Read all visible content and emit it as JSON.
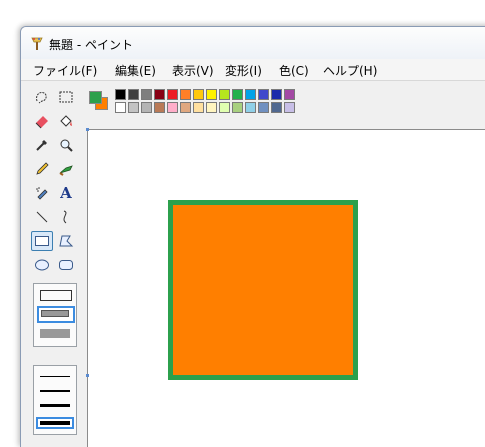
{
  "window": {
    "title": "無題 - ペイント"
  },
  "menu": [
    {
      "label": "ファイル(F)"
    },
    {
      "label": "編集(E)"
    },
    {
      "label": "表示(V)"
    },
    {
      "label": "変形(I)"
    },
    {
      "label": "色(C)"
    },
    {
      "label": "ヘルプ(H)"
    }
  ],
  "tools": [
    {
      "icon": "free-select-icon"
    },
    {
      "icon": "rect-select-icon"
    },
    {
      "icon": "eraser-icon"
    },
    {
      "icon": "fill-bucket-icon"
    },
    {
      "icon": "eyedropper-icon"
    },
    {
      "icon": "magnifier-icon"
    },
    {
      "icon": "pencil-icon"
    },
    {
      "icon": "brush-icon"
    },
    {
      "icon": "airbrush-icon"
    },
    {
      "icon": "text-icon",
      "glyph": "A"
    },
    {
      "icon": "line-icon"
    },
    {
      "icon": "curve-icon"
    },
    {
      "icon": "rectangle-icon",
      "selected": true
    },
    {
      "icon": "polygon-icon"
    },
    {
      "icon": "ellipse-icon"
    },
    {
      "icon": "rounded-rect-icon"
    }
  ],
  "colors": {
    "foreground": "#2ca04c",
    "background": "#ff7f00",
    "palette_row1": [
      "#000000",
      "#404040",
      "#7f7f7f",
      "#880015",
      "#ed1c24",
      "#ff7f27",
      "#ffc90e",
      "#fff200",
      "#b5e61d",
      "#22b14c",
      "#00a2e8",
      "#3f48cc",
      "#1c2bab",
      "#a349a4"
    ],
    "palette_row2": [
      "#ffffff",
      "#c3c3c3",
      "#b4b4b4",
      "#b97a57",
      "#ffaec9",
      "#e0a880",
      "#ffe0a0",
      "#fff5c0",
      "#e0ffb0",
      "#a8d080",
      "#90d0e8",
      "#7090c0",
      "#506890",
      "#c8bfe7"
    ]
  },
  "canvas": {
    "shape": "rectangle",
    "fill_color": "#ff7f00",
    "border_color": "#2ca04c"
  }
}
